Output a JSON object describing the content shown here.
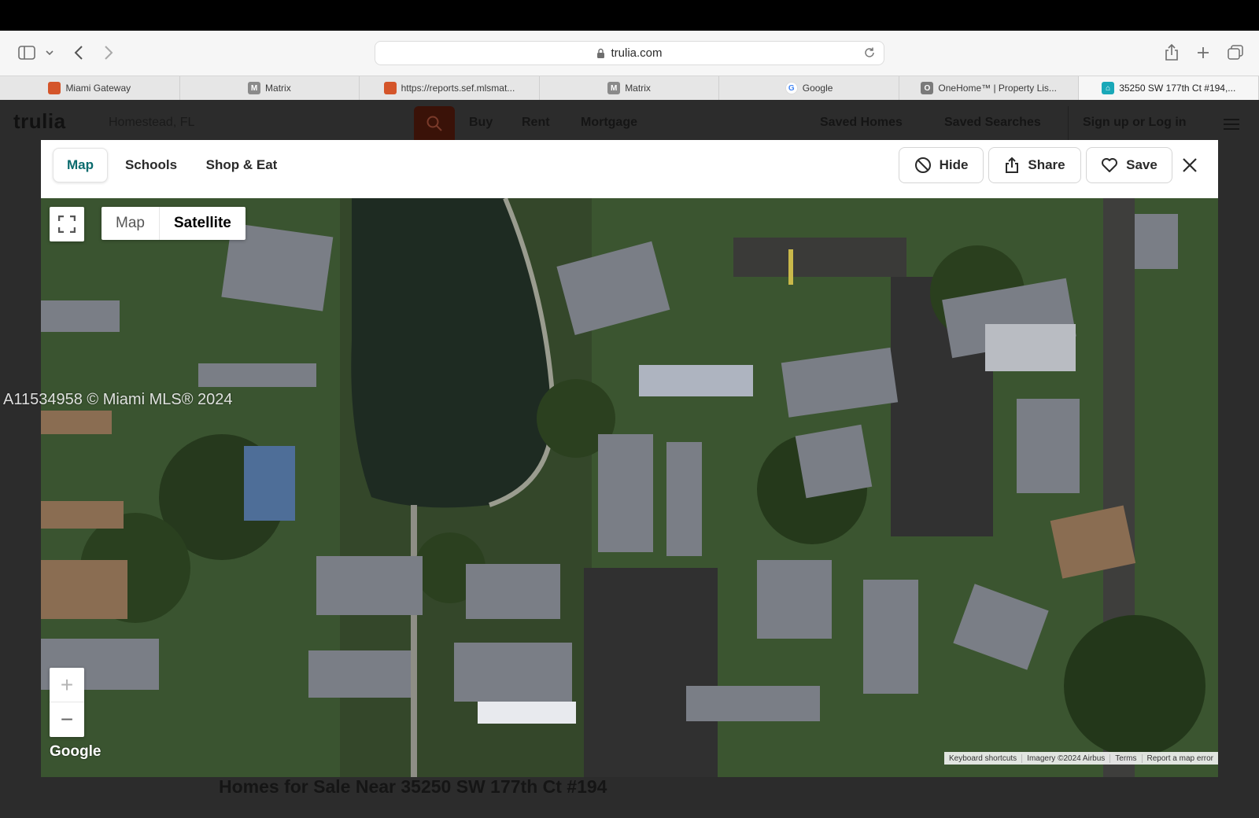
{
  "browser": {
    "url": "trulia.com",
    "tabs": [
      {
        "label": "Miami Gateway",
        "favicon": "M",
        "favicon_color": "#d4552a"
      },
      {
        "label": "Matrix",
        "favicon": "M",
        "favicon_color": "#8a8a8a"
      },
      {
        "label": "https://reports.sef.mlsmat...",
        "favicon": "",
        "favicon_color": "#d4552a"
      },
      {
        "label": "Matrix",
        "favicon": "M",
        "favicon_color": "#8a8a8a"
      },
      {
        "label": "Google",
        "favicon": "G",
        "favicon_color": "#4285f4"
      },
      {
        "label": "OneHome™ | Property Lis...",
        "favicon": "O",
        "favicon_color": "#7a7a7a"
      },
      {
        "label": "35250 SW 177th Ct #194,...",
        "favicon": "⌂",
        "favicon_color": "#19a8b8"
      }
    ]
  },
  "site": {
    "logo": "trulia",
    "search_value": "Homestead, FL",
    "nav": {
      "buy": "Buy",
      "rent": "Rent",
      "mortgage": "Mortgage",
      "saved_homes": "Saved Homes",
      "saved_searches": "Saved Searches",
      "signup": "Sign up or Log in"
    },
    "homes_title": "Homes for Sale Near 35250 SW 177th Ct #194"
  },
  "modal": {
    "tabs": {
      "map": "Map",
      "schools": "Schools",
      "shop_eat": "Shop & Eat"
    },
    "actions": {
      "hide": "Hide",
      "share": "Share",
      "save": "Save"
    },
    "accent": "#0b6b6e"
  },
  "map": {
    "type_map": "Map",
    "type_satellite": "Satellite",
    "selected_type": "Satellite",
    "zoom_in": "+",
    "zoom_out": "−",
    "google_logo": "Google",
    "attribution": {
      "keyboard": "Keyboard shortcuts",
      "imagery": "Imagery ©2024 Airbus",
      "terms": "Terms",
      "report": "Report a map error"
    }
  },
  "watermark": "A11534958 © Miami MLS® 2024"
}
